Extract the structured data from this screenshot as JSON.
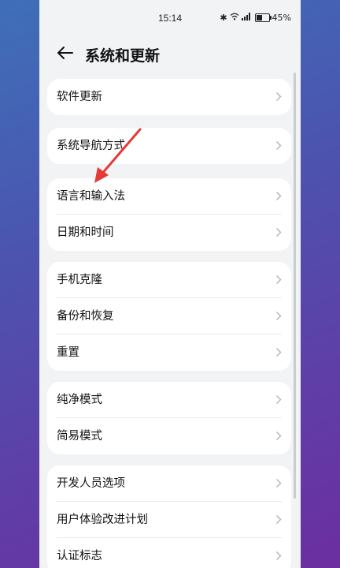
{
  "status_bar": {
    "time": "15:14",
    "battery": "45%",
    "icons": [
      "bluetooth-icon",
      "wifi-icon",
      "signal-icon",
      "battery-icon"
    ]
  },
  "header": {
    "title": "系统和更新",
    "back_icon": "back-arrow-icon"
  },
  "groups": [
    {
      "items": [
        {
          "label": "软件更新"
        }
      ]
    },
    {
      "items": [
        {
          "label": "系统导航方式"
        }
      ]
    },
    {
      "items": [
        {
          "label": "语言和输入法"
        },
        {
          "label": "日期和时间"
        }
      ]
    },
    {
      "items": [
        {
          "label": "手机克隆"
        },
        {
          "label": "备份和恢复"
        },
        {
          "label": "重置"
        }
      ]
    },
    {
      "items": [
        {
          "label": "纯净模式"
        },
        {
          "label": "简易模式"
        }
      ]
    },
    {
      "items": [
        {
          "label": "开发人员选项"
        },
        {
          "label": "用户体验改进计划"
        },
        {
          "label": "认证标志"
        }
      ]
    }
  ],
  "colors": {
    "annotation_arrow": "#e53935",
    "card_background": "#ffffff",
    "page_background": "#f1f3f5"
  }
}
